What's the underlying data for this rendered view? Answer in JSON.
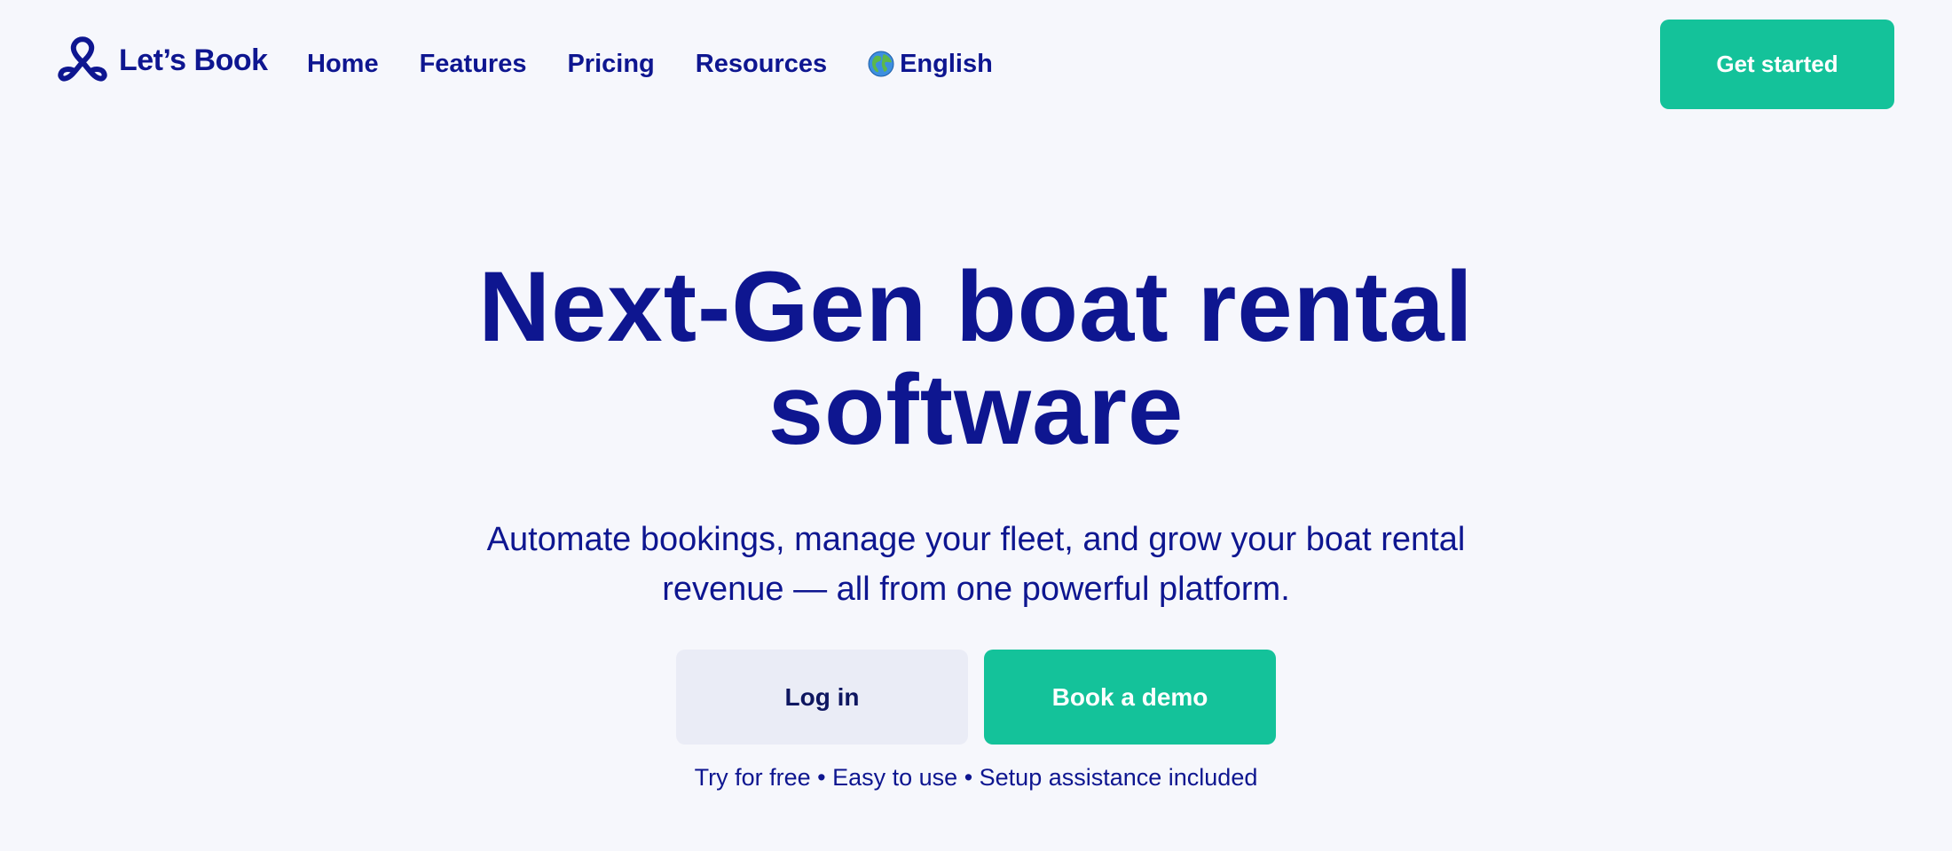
{
  "header": {
    "logo_text": "Let’s Book",
    "logo_icon": "pretzel-logo-icon",
    "nav": [
      {
        "label": "Home"
      },
      {
        "label": "Features"
      },
      {
        "label": "Pricing"
      },
      {
        "label": "Resources"
      }
    ],
    "language": {
      "label": "English",
      "icon": "globe-icon"
    },
    "cta_label": "Get started"
  },
  "hero": {
    "title_line1": "Next-Gen boat rental",
    "title_line2": "software",
    "subtitle": "Automate bookings, manage your fleet, and grow your boat rental revenue — all from one powerful platform.",
    "login_label": "Log in",
    "demo_label": "Book a demo",
    "note": "Try for free • Easy to use • Setup assistance included"
  },
  "colors": {
    "background": "#f6f7fc",
    "brand_navy": "#0e1690",
    "accent_green": "#14c29a",
    "secondary_button": "#eaecf6"
  }
}
